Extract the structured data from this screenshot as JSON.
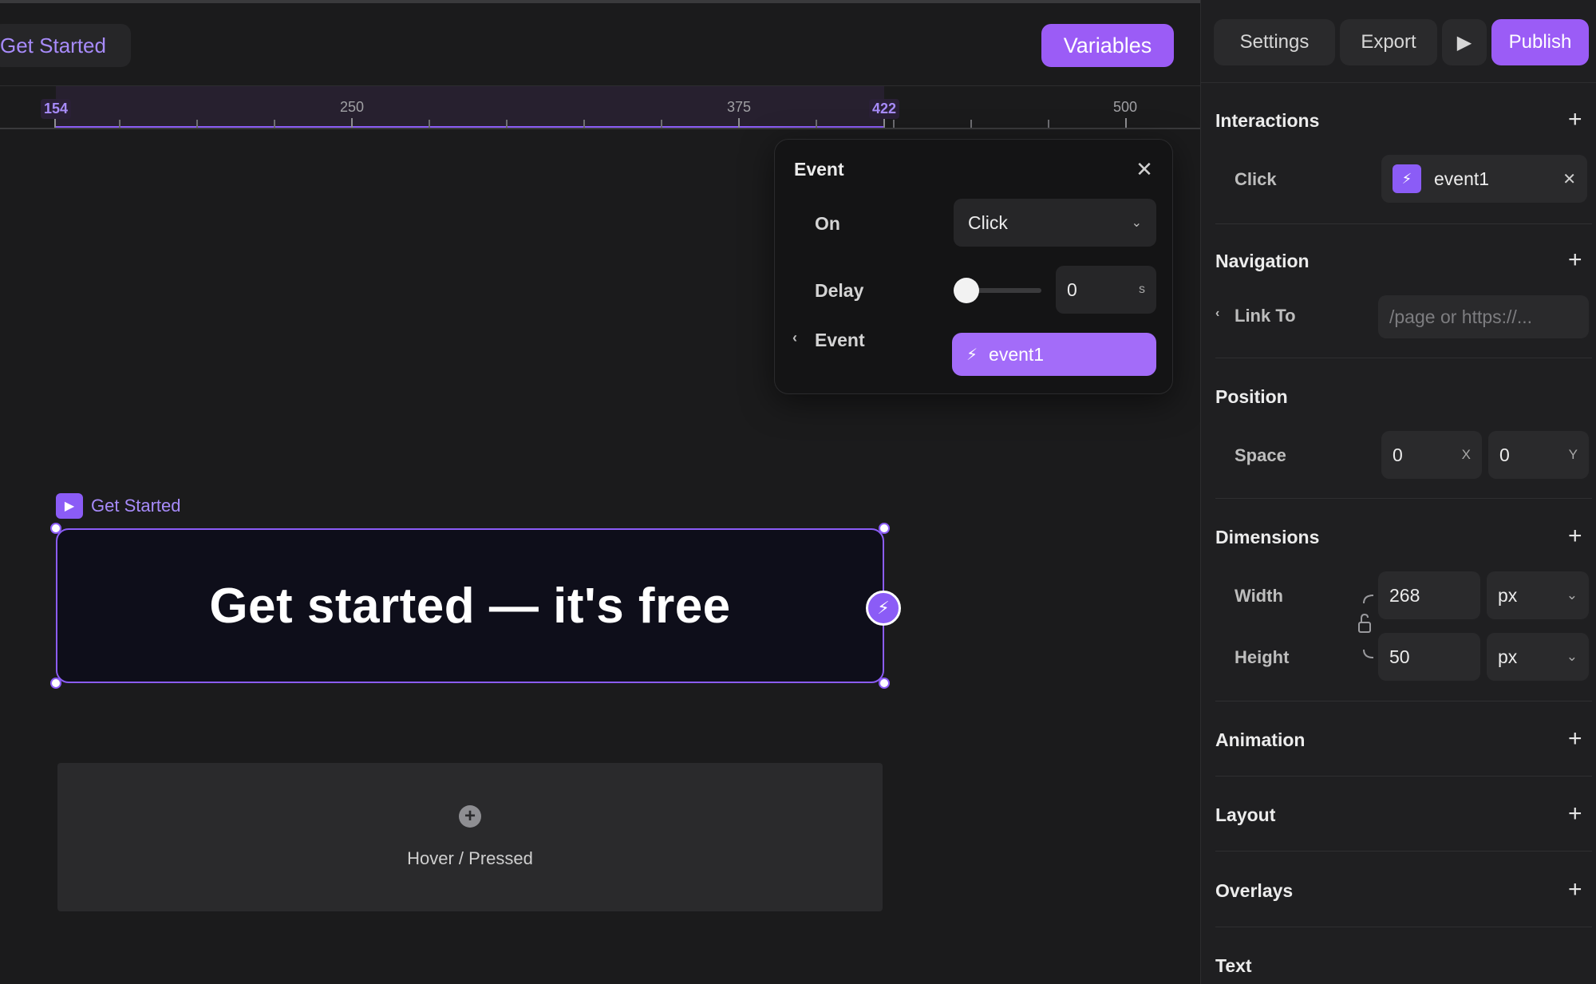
{
  "canvas": {
    "breadcrumb": "Get Started",
    "variables_label": "Variables",
    "ruler": {
      "labels": [
        {
          "text": "154",
          "highlight": true
        },
        {
          "text": "250",
          "highlight": false
        },
        {
          "text": "375",
          "highlight": false
        },
        {
          "text": "422",
          "highlight": true
        },
        {
          "text": "500",
          "highlight": false
        }
      ]
    },
    "component": {
      "tag": "Get Started",
      "cta_text": "Get started — it's free"
    },
    "hover_slot_label": "Hover / Pressed"
  },
  "event_popover": {
    "title": "Event",
    "on_label": "On",
    "on_value": "Click",
    "delay_label": "Delay",
    "delay_value": "0",
    "delay_unit": "s",
    "event_label": "Event",
    "event_value": "event1"
  },
  "inspector": {
    "top_buttons": {
      "settings": "Settings",
      "export": "Export",
      "publish": "Publish"
    },
    "interactions": {
      "title": "Interactions",
      "row_label": "Click",
      "event_name": "event1"
    },
    "navigation": {
      "title": "Navigation",
      "row_label": "Link To",
      "placeholder": "/page or https://..."
    },
    "position": {
      "title": "Position",
      "row_label": "Space",
      "x": "0",
      "x_suffix": "X",
      "y": "0",
      "y_suffix": "Y"
    },
    "dimensions": {
      "title": "Dimensions",
      "width_label": "Width",
      "width_value": "268",
      "width_unit": "px",
      "height_label": "Height",
      "height_value": "50",
      "height_unit": "px"
    },
    "sections": {
      "animation": "Animation",
      "layout": "Layout",
      "overlays": "Overlays",
      "text": "Text"
    }
  },
  "colors": {
    "accent": "#9b5cf6",
    "background": "#1b1b1c",
    "panel": "#1f1f21"
  }
}
